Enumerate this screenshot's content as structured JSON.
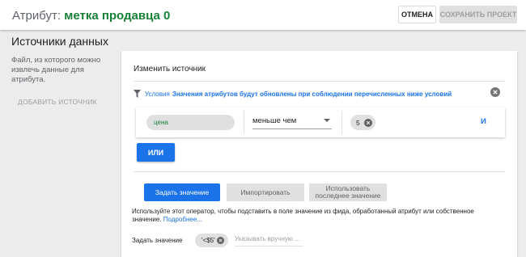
{
  "header": {
    "attr_label": "Атрибут: ",
    "attr_name": "метка продавца 0",
    "cancel_label": "ОТМЕНА",
    "save_label": "СОХРАНИТЬ ПРОЕКТ"
  },
  "sidebar": {
    "title": "Источники данных",
    "description": "Файл, из которого можно извлечь данные для атрибута.",
    "add_source_label": "ДОБАВИТЬ ИСТОЧНИК"
  },
  "editor": {
    "title": "Изменить источник",
    "conditions": {
      "label": "Условия",
      "description": "Значения атрибутов будут обновлены при соблюдении перечисленных ниже условий",
      "row": {
        "attribute": "цена",
        "operator": "меньше чем",
        "value": "5",
        "and_label": "И"
      },
      "or_label": "ИЛИ"
    },
    "tabs": [
      {
        "label": "Задать значение",
        "active": true
      },
      {
        "label": "Импортировать",
        "active": false
      },
      {
        "label": "Использовать последнее значение",
        "active": false
      }
    ],
    "help_text": "Используйте этот оператор, чтобы подставить в поле значение из фида, обработанный атрибут или собственное значение.",
    "help_link": "Подробнее...",
    "set_value": {
      "label": "Задать значение",
      "chip": "'<$5'",
      "manual_placeholder": "Указывать вручную ..."
    }
  },
  "colors": {
    "accent": "#1a73e8",
    "attribute_green": "#188038",
    "chip_bg": "#e0e0e0"
  },
  "icons": [
    "filter-icon",
    "close-circle-icon",
    "chip-remove-icon",
    "dropdown-caret-icon"
  ]
}
